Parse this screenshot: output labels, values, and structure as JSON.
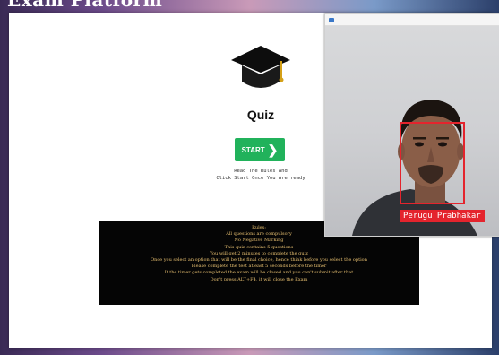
{
  "page": {
    "heading": "Exam Platform"
  },
  "quiz": {
    "title": "Quiz",
    "start_label": "START",
    "instructions": [
      "Read The Rules And",
      "Click Start Once You Are ready"
    ]
  },
  "rules": {
    "lines": [
      "Rules:",
      "All questions are compulsory",
      "No Negative Marking",
      "This quiz contains 5 questions",
      "You will get 2 minutes to complete the quiz",
      "Once you select an option that will be the final choice, hence think before you select the option",
      "Please complete the test atleast 5 seconds before the timer",
      "If the timer gets completed the exam will be closed and you can't submit after that",
      "Don't press ALT+F4, it will close the Exam"
    ]
  },
  "camera": {
    "detected_name": "Perugu Prabhakar"
  },
  "colors": {
    "start_button": "#21b25b",
    "rules_text": "#e8c071",
    "detection_box": "#e4242d"
  },
  "icons": {
    "quiz": "graduation-cap-icon",
    "start": "chevron-right-icon",
    "camera_app": "camera-app-icon"
  }
}
